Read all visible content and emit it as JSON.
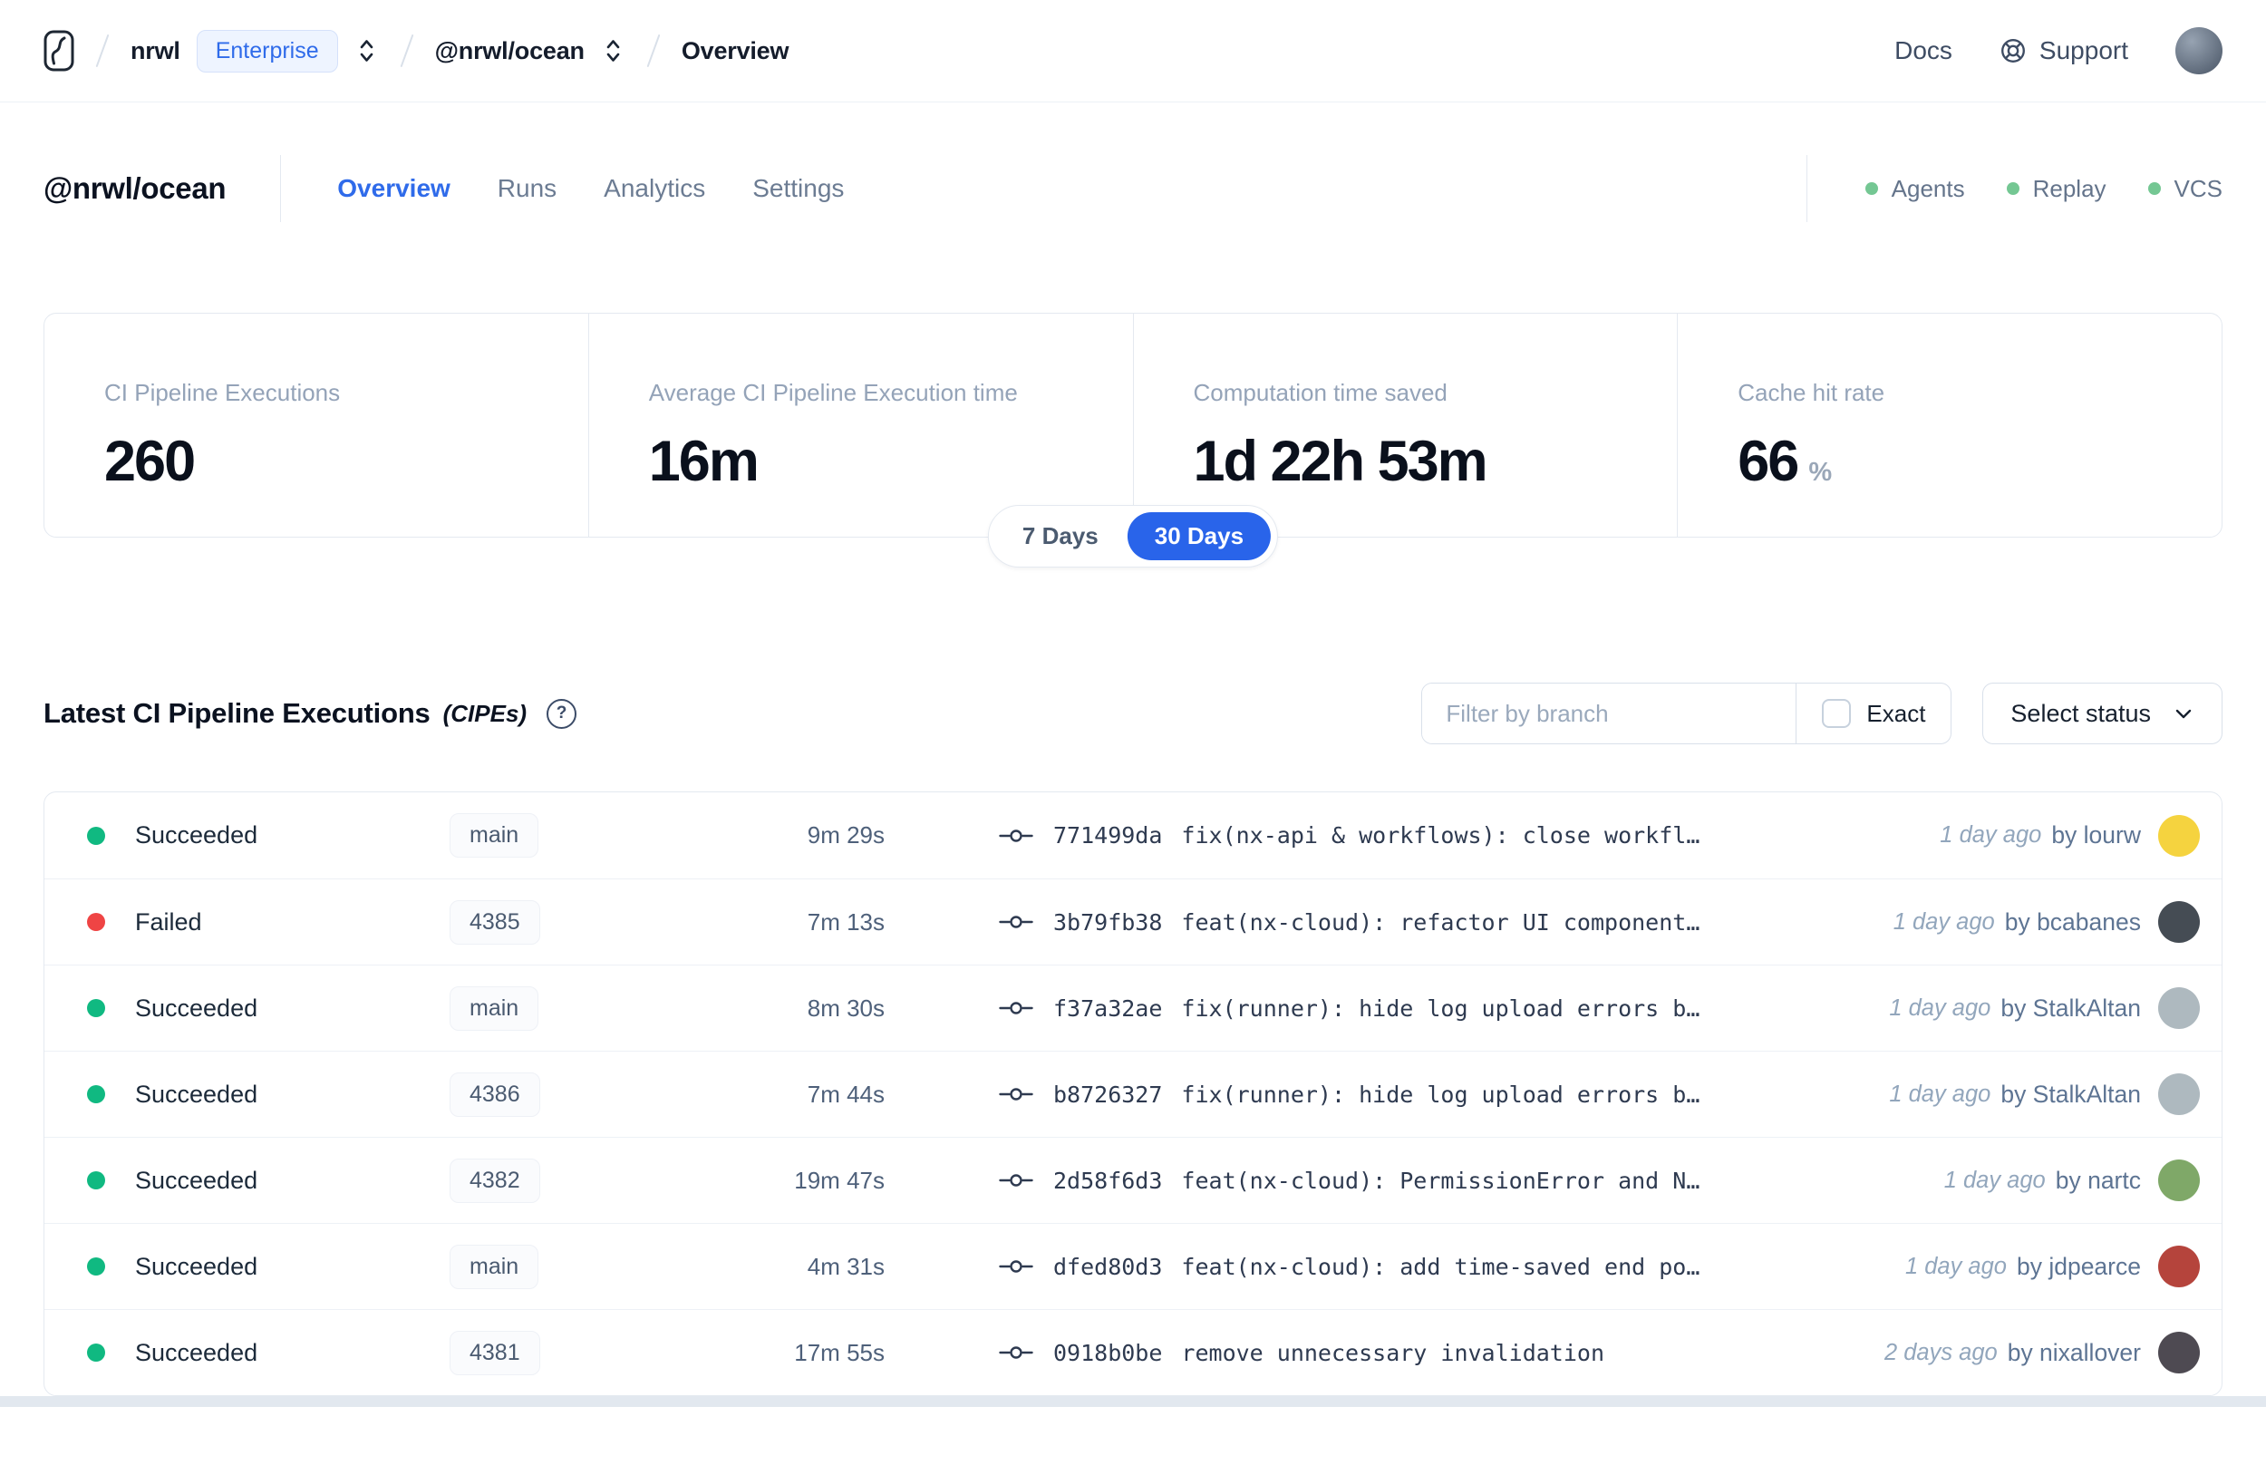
{
  "topbar": {
    "org": "nrwl",
    "org_badge": "Enterprise",
    "workspace": "@nrwl/ocean",
    "page": "Overview",
    "docs_label": "Docs",
    "support_label": "Support"
  },
  "header": {
    "title": "@nrwl/ocean",
    "tabs": [
      {
        "label": "Overview",
        "active": true
      },
      {
        "label": "Runs"
      },
      {
        "label": "Analytics"
      },
      {
        "label": "Settings"
      }
    ],
    "statuses": [
      {
        "label": "Agents",
        "dot_color": "#74C793"
      },
      {
        "label": "Replay",
        "dot_color": "#74C793"
      },
      {
        "label": "VCS",
        "dot_color": "#74C793"
      }
    ]
  },
  "stats": {
    "cards": [
      {
        "label": "CI Pipeline Executions",
        "value": "260"
      },
      {
        "label": "Average CI Pipeline Execution time",
        "value": "16m"
      },
      {
        "label": "Computation time saved",
        "value": "1d 22h 53m"
      },
      {
        "label": "Cache hit rate",
        "value": "66",
        "suffix": "%"
      }
    ],
    "range_options": [
      {
        "label": "7 Days"
      },
      {
        "label": "30 Days",
        "active": true
      }
    ]
  },
  "cipes": {
    "title": "Latest CI Pipeline Executions",
    "title_suffix": "(CIPEs)",
    "help_glyph": "?",
    "filter_placeholder": "Filter by branch",
    "exact_label": "Exact",
    "status_select_label": "Select status",
    "rows": [
      {
        "status": "Succeeded",
        "status_color": "#10B981",
        "branch": "main",
        "duration": "9m 29s",
        "commit_hash": "771499da",
        "commit_message": "fix(nx-api & workflows): close workfl…",
        "time_ago": "1 day ago",
        "by_author": "by lourw",
        "avatar_color": "#F5D33F"
      },
      {
        "status": "Failed",
        "status_color": "#EF4444",
        "branch": "4385",
        "duration": "7m 13s",
        "commit_hash": "3b79fb38",
        "commit_message": "feat(nx-cloud): refactor UI component…",
        "time_ago": "1 day ago",
        "by_author": "by bcabanes",
        "avatar_color": "#454C54"
      },
      {
        "status": "Succeeded",
        "status_color": "#10B981",
        "branch": "main",
        "duration": "8m 30s",
        "commit_hash": "f37a32ae",
        "commit_message": "fix(runner): hide log upload errors b…",
        "time_ago": "1 day ago",
        "by_author": "by StalkAltan",
        "avatar_color": "#AEB9BF"
      },
      {
        "status": "Succeeded",
        "status_color": "#10B981",
        "branch": "4386",
        "duration": "7m 44s",
        "commit_hash": "b8726327",
        "commit_message": "fix(runner): hide log upload errors b…",
        "time_ago": "1 day ago",
        "by_author": "by StalkAltan",
        "avatar_color": "#AEB9BF"
      },
      {
        "status": "Succeeded",
        "status_color": "#10B981",
        "branch": "4382",
        "duration": "19m 47s",
        "commit_hash": "2d58f6d3",
        "commit_message": "feat(nx-cloud): PermissionError and N…",
        "time_ago": "1 day ago",
        "by_author": "by nartc",
        "avatar_color": "#7FA868"
      },
      {
        "status": "Succeeded",
        "status_color": "#10B981",
        "branch": "main",
        "duration": "4m 31s",
        "commit_hash": "dfed80d3",
        "commit_message": "feat(nx-cloud): add time-saved end po…",
        "time_ago": "1 day ago",
        "by_author": "by jdpearce",
        "avatar_color": "#B5443C"
      },
      {
        "status": "Succeeded",
        "status_color": "#10B981",
        "branch": "4381",
        "duration": "17m 55s",
        "commit_hash": "0918b0be",
        "commit_message": "remove unnecessary invalidation",
        "time_ago": "2 days ago",
        "by_author": "by nixallover",
        "avatar_color": "#4E4A52"
      }
    ]
  },
  "colors": {
    "accent_blue": "#2964EA",
    "success_green": "#10B981",
    "failed_red": "#EF4444",
    "indicator_green": "#74C793"
  }
}
